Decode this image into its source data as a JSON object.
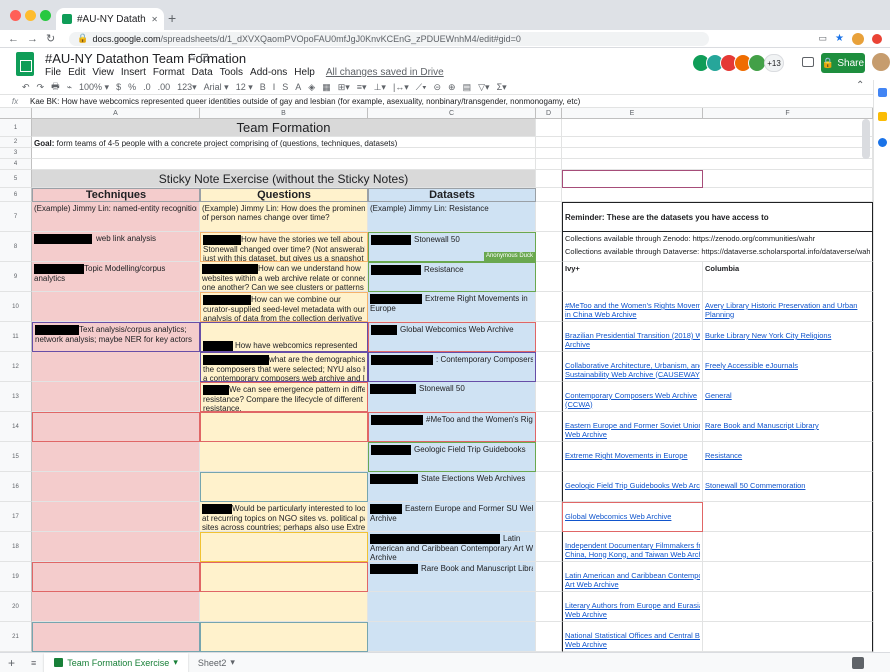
{
  "browser": {
    "tab_title": "#AU-NY Datathon Team Format",
    "tab_close": "✕",
    "new_tab": "+",
    "url_domain": "docs.google.com",
    "url_path": "/spreadsheets/d/1_dXVXQaomPVOpoFAU0mfJgJ0KnvKCEnG_zPDUEWnhM4/edit#gid=0",
    "back": "←",
    "forward": "→",
    "reload": "↻",
    "traffic_colors": [
      "#ff5f57",
      "#febc2e",
      "#28c840"
    ]
  },
  "app": {
    "doc_title": "#AU-NY Datathon Team Formation",
    "star": "☆ ⊡",
    "menus": [
      "File",
      "Edit",
      "View",
      "Insert",
      "Format",
      "Data",
      "Tools",
      "Add-ons",
      "Help"
    ],
    "saved_status": "All changes saved in Drive",
    "collab_colors": [
      "#0f9d58",
      "#26a69a",
      "#e53935",
      "#ef6c00",
      "#43a047"
    ],
    "collab_extra": "+13",
    "share_label": "Share",
    "share_icon": "lock-icon"
  },
  "toolbar": {
    "items": [
      "↶",
      "↷",
      "🖶",
      "⌁",
      "100% ▾",
      "$",
      "%",
      ".0",
      ".00",
      "123▾",
      "Arial ▾",
      "12 ▾",
      "B",
      "I",
      "S",
      "A",
      "◈",
      "▦",
      "⊞▾",
      "≡▾",
      "⊥▾",
      "|↔▾",
      "⟋▾",
      "⊝",
      "⊕",
      "▤",
      "▽▾",
      "Σ▾"
    ],
    "collapse": "⌃"
  },
  "formula_bar": {
    "fx": "fx",
    "content": "Kae BK: How have webcomics represented queer identities outside of gay and lesbian (for example, asexuality, nonbinary/transgender, nonmonogamy, etc)"
  },
  "columns": [
    "A",
    "B",
    "C",
    "D",
    "E",
    "F"
  ],
  "rows": [
    "1",
    "2",
    "3",
    "4",
    "5",
    "6",
    "7",
    "8",
    "9",
    "10",
    "11",
    "12",
    "13",
    "14",
    "15",
    "16",
    "17",
    "18",
    "19",
    "20",
    "21"
  ],
  "sheet": {
    "title": "Team Formation",
    "goal_label": "Goal:",
    "goal_text": " form teams of 4-5 people with a concrete project comprising of (questions, techniques, datasets)",
    "section_title": "Sticky Note Exercise (without the Sticky Notes)",
    "col_headers": [
      "Techniques",
      "Questions",
      "Datasets"
    ],
    "techniques": [
      "(Example) Jimmy Lin: named-entity recognition",
      "web link analysis",
      "Topic Modelling/corpus analytics",
      "",
      "Text analysis/corpus analytics;",
      "network analysis; maybe NER for key actors"
    ],
    "questions": {
      "r7": [
        "(Example) Jimmy Lin: How does the prominence",
        "of person names change over time?"
      ],
      "r8": [
        "How have the stories we tell about",
        "Stonewall changed over time? (Not answerable",
        "just with this dataset, but gives us a snapshot of"
      ],
      "r9": [
        "How can we understand how",
        "websites within a web archive relate or connect to",
        "one another? Can we see clusters or patterns of"
      ],
      "r10": [
        "How can we combine our",
        "curator-supplied seed-level metadata with our",
        "analysis of data from the collection derivative"
      ],
      "r11": "How have webcomics represented queer i",
      "r12": [
        "what are the demographics of",
        "the composers that were selected; NYU also has",
        "a contemporary composers web archive and I am"
      ],
      "r13": [
        "We can see emergence pattern in different",
        "resistance? Compare the lifecycle of different",
        "resistance."
      ],
      "r17": [
        "Would be particularly interested to look",
        "at recurring topics on NGO sites vs. political party",
        "sites across countries; perhaps also use Extreme"
      ]
    },
    "datasets": {
      "r7": "(Example) Jimmy Lin: Resistance",
      "r8": "Stonewall 50",
      "r8_tag": "Anonymous Duck",
      "r9": "Resistance",
      "r10": [
        "Extreme Right Movements in",
        "Europe"
      ],
      "r11": "Global Webcomics Web Archive",
      "r12": ": Contemporary Composers",
      "r13": "Stonewall 50",
      "r14": "#MeToo and the Women's Rights",
      "r15": "Geologic Field Trip Guidebooks",
      "r16": "State Elections Web Archives",
      "r17": [
        "Eastern Europe and Former SU Web",
        "Archive"
      ],
      "r18": [
        "Latin",
        "American and Caribbean Contemporary Art Web",
        "Archive"
      ],
      "r19": "Rare Book and Manuscript Library"
    },
    "reminder": {
      "title": "Reminder: These are the datasets you have access to",
      "zenodo": "Collections available through Zenodo: https://zenodo.org/communities/wahr",
      "dataverse": "Collections available through Dataverse: https://dataverse.scholarsportal.info/dataverse/wahr",
      "col_ivy": "Ivy+",
      "col_columbia": "Columbia",
      "ivy_links": [
        [
          "#MeToo and the Women's Rights Movement",
          "in China Web Archive"
        ],
        [
          "Brazilian Presidential Transition (2018) Web",
          "Archive"
        ],
        [
          "Collaborative Architecture, Urbanism, and",
          "Sustainability Web Archive (CAUSEWAY)"
        ],
        [
          "Contemporary Composers Web Archive",
          "(CCWA)"
        ],
        [
          "Eastern Europe and Former Soviet Union",
          "Web Archive"
        ],
        [
          "Extreme Right Movements in Europe"
        ],
        [
          "Geologic Field Trip Guidebooks Web Archive"
        ],
        [
          "Global Webcomics Web Archive"
        ],
        [
          "Independent Documentary Filmmakers from",
          "China, Hong Kong, and Taiwan Web Archive"
        ],
        [
          "Latin American and Caribbean Contemporary",
          "Art Web Archive"
        ],
        [
          "Literary Authors from Europe and Eurasia",
          "Web Archive"
        ],
        [
          "National Statistical Offices and Central Banks",
          "Web Archive"
        ]
      ],
      "columbia_links": [
        [
          "Avery Library Historic Preservation and Urban",
          "Planning"
        ],
        [
          "Burke Library New York City Religions"
        ],
        [
          "Freely Accessible eJournals"
        ],
        [
          "General"
        ],
        [
          "Rare Book and Manuscript Library"
        ],
        [
          "Resistance"
        ],
        [
          "Stonewall 50 Commemoration"
        ],
        [
          ""
        ],
        [
          ""
        ],
        [
          ""
        ],
        [
          ""
        ],
        [
          ""
        ]
      ]
    }
  },
  "sheet_tabs": {
    "add": "+",
    "all": "≡",
    "tabs": [
      "Team Formation Exercise",
      "Sheet2"
    ]
  },
  "colors": {
    "pink": "#f4cccc",
    "yellow": "#fff2cc",
    "blue": "#cfe2f3",
    "grey": "#d9d9d9",
    "share_green": "#1e8e3e"
  }
}
